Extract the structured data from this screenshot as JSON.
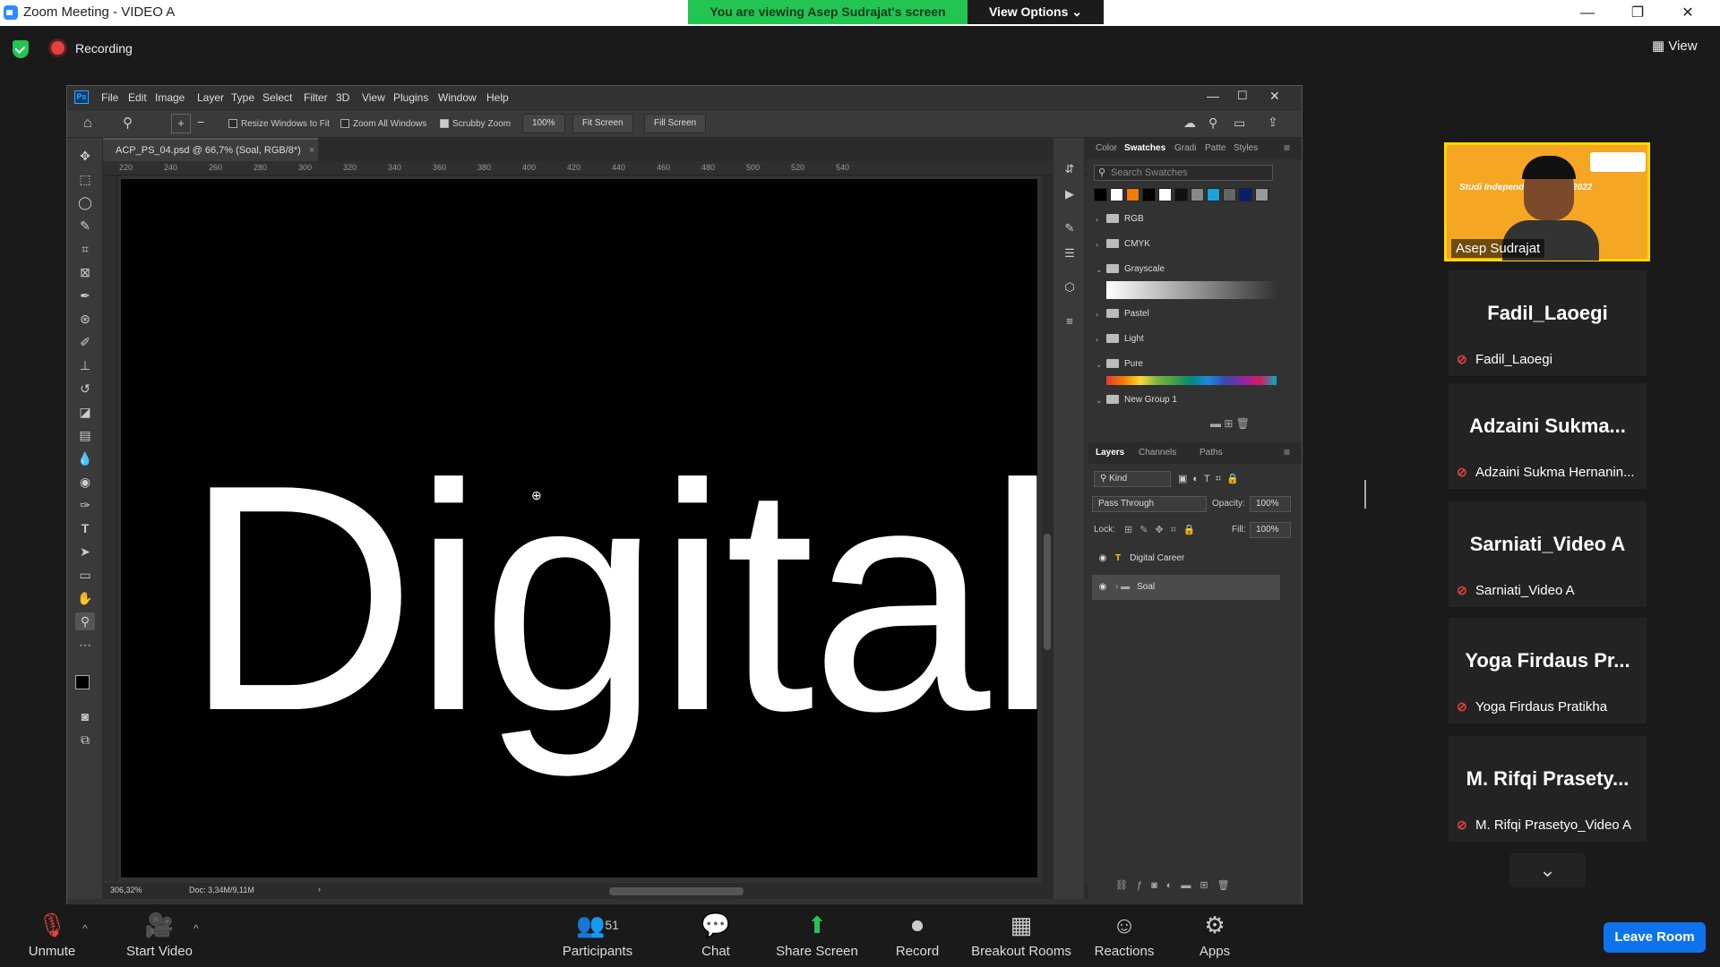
{
  "zoom": {
    "window_title": "Zoom Meeting - VIDEO A",
    "viewing_banner": "You are viewing Asep Sudrajat's screen",
    "view_options": "View Options ⌄",
    "recording_label": "Recording",
    "view_label": "View",
    "leave_label": "Leave Room",
    "toolbar": {
      "unmute": "Unmute",
      "start_video": "Start Video",
      "participants": "Participants",
      "participants_count": "51",
      "chat": "Chat",
      "share_screen": "Share Screen",
      "record": "Record",
      "breakout_rooms": "Breakout Rooms",
      "reactions": "Reactions",
      "apps": "Apps"
    },
    "active_speaker": {
      "name": "Asep Sudrajat",
      "brand_text": "Studi Independ MyEduSol 2022"
    },
    "participants": [
      {
        "display": "Fadil_Laoegi",
        "label": "Fadil_Laoegi"
      },
      {
        "display": "Adzaini Sukma...",
        "label": "Adzaini Sukma Hernanin..."
      },
      {
        "display": "Sarniati_Video A",
        "label": "Sarniati_Video A"
      },
      {
        "display": "Yoga Firdaus Pr...",
        "label": "Yoga Firdaus Pratikha"
      },
      {
        "display": "M. Rifqi Prasety...",
        "label": "M. Rifqi Prasetyo_Video A"
      }
    ]
  },
  "photoshop": {
    "menu": [
      "File",
      "Edit",
      "Image",
      "Layer",
      "Type",
      "Select",
      "Filter",
      "3D",
      "View",
      "Plugins",
      "Window",
      "Help"
    ],
    "options": {
      "resize_windows": "Resize Windows to Fit",
      "zoom_all": "Zoom All Windows",
      "scrubby_zoom": "Scrubby Zoom",
      "zoom_value": "100%",
      "fit_screen": "Fit Screen",
      "fill_screen": "Fill Screen"
    },
    "doc_tab": "ACP_PS_04.psd @ 66,7% (Soal, RGB/8*)",
    "ruler_ticks": [
      "220",
      "240",
      "260",
      "280",
      "300",
      "320",
      "340",
      "360",
      "380",
      "400",
      "420",
      "440",
      "460",
      "480",
      "500",
      "520",
      "540"
    ],
    "canvas_text": "Digital C",
    "status_zoom": "306,32%",
    "status_doc": "Doc: 3,34M/9,11M",
    "swatch_tabs": [
      "Color",
      "Swatches",
      "Gradi",
      "Patte",
      "Styles"
    ],
    "swatch_search_placeholder": "Search Swatches",
    "swatch_groups": [
      "RGB",
      "CMYK",
      "Grayscale",
      "Pastel",
      "Light",
      "Pure",
      "New Group 1"
    ],
    "layer_tabs": [
      "Layers",
      "Channels",
      "Paths"
    ],
    "kind_label": "Kind",
    "blend_mode": "Pass Through",
    "opacity_label": "Opacity:",
    "opacity_value": "100%",
    "lock_label": "Lock:",
    "fill_label": "Fill:",
    "fill_value": "100%",
    "layers": [
      "Digital Career",
      "Soal"
    ]
  }
}
